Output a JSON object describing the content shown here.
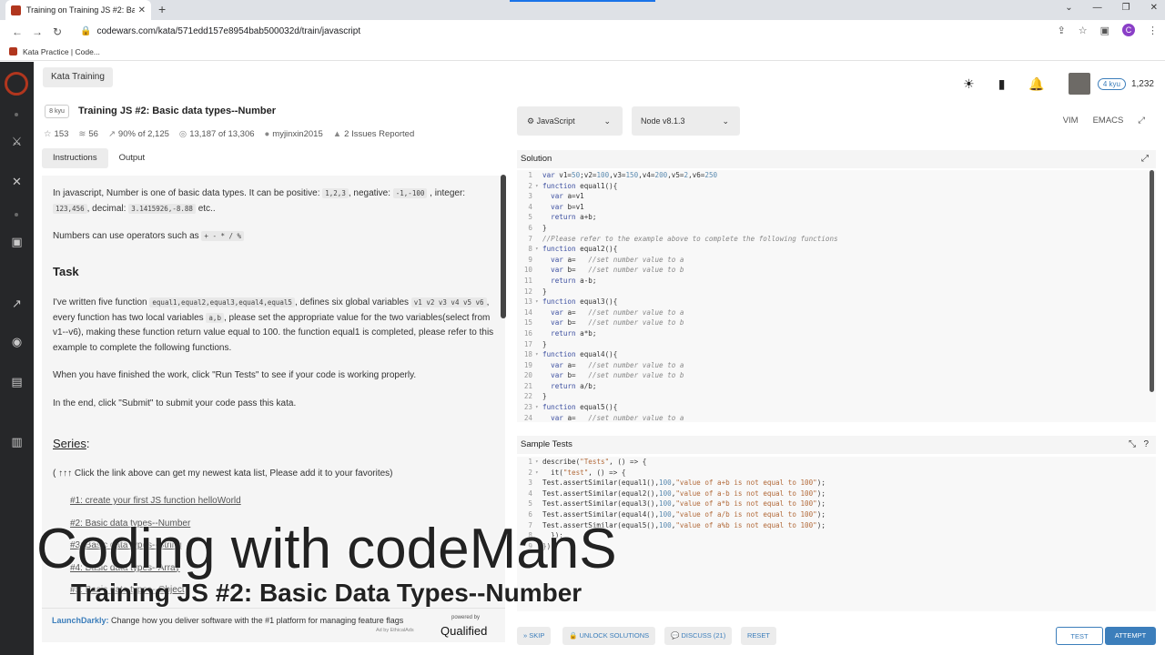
{
  "browser": {
    "tab_title": "Training on Training JS #2: Basic",
    "url": "codewars.com/kata/571edd157e8954bab500032d/train/javascript",
    "bookmark": "Kata Practice | Code..."
  },
  "header": {
    "section_label": "Kata Training",
    "rank": "4 kyu",
    "honor": "1,232"
  },
  "kata": {
    "kyu": "8 kyu",
    "title": "Training JS #2: Basic data types--Number",
    "stats": {
      "stars": "153",
      "collections": "56",
      "satisfaction": "90% of 2,125",
      "completed": "13,187 of 13,306",
      "author": "myjinxin2015",
      "issues": "2 Issues Reported"
    },
    "tabs": [
      "Instructions",
      "Output"
    ]
  },
  "description": {
    "p1_a": "In javascript, Number is one of basic data types. It can be positive: ",
    "p1_code1": "1,2,3",
    "p1_b": ", negative: ",
    "p1_code2": "-1,-100",
    "p1_c": " , integer: ",
    "p1_code3": "123,456",
    "p1_d": ", decimal: ",
    "p1_code4": "3.1415926,-8.88",
    "p1_e": " etc..",
    "p2_a": "Numbers can use operators such as ",
    "p2_code": "+ - * / %",
    "task_heading": "Task",
    "p3_a": "I've written five function ",
    "p3_code1": "equal1,equal2,equal3,equal4,equal5",
    "p3_b": ", defines six global variables ",
    "p3_code2": "v1 v2 v3 v4 v5 v6",
    "p3_c": ", every function has two local variables ",
    "p3_code3": "a,b",
    "p3_d": ", please set the appropriate value for the two variables(select from v1--v6), making these function return value equal to 100. the function equal1 is completed, please refer to this example to complete the following functions.",
    "p4": "When you have finished the work, click \"Run Tests\" to see if your code is working properly.",
    "p5": "In the end, click \"Submit\" to submit your code pass this kata.",
    "series_heading": "Series",
    "series_colon": ":",
    "p6": "( ↑↑↑ Click the link above can get my newest kata list, Please add it to your favorites)",
    "series_links": [
      "#1: create your first JS function helloWorld",
      "#2: Basic data types--Number",
      "#3: Basic data types--String",
      "#4: Basic data types--Array",
      "#5: Basic data types--Object"
    ]
  },
  "ad": {
    "brand": "LaunchDarkly:",
    "text": " Change how you deliver software with the #1 platform for managing feature flags",
    "note": "Ad by EthicalAds",
    "powered": "powered by",
    "qualified": "Qualified"
  },
  "editor": {
    "language": "JavaScript",
    "runtime": "Node v8.1.3",
    "modes": [
      "VIM",
      "EMACS"
    ],
    "solution_label": "Solution",
    "tests_label": "Sample Tests"
  },
  "actions": {
    "skip": "SKIP",
    "unlock": "UNLOCK SOLUTIONS",
    "discuss": "DISCUSS (21)",
    "reset": "RESET",
    "test": "TEST",
    "attempt": "ATTEMPT"
  },
  "overlay": {
    "line1": "Coding with codeManS",
    "line2": "Training JS #2: Basic Data Types--Number"
  },
  "colors": {
    "brand_red": "#b1361e",
    "link_blue": "#3c7ebb",
    "nav_bg": "#262729"
  }
}
